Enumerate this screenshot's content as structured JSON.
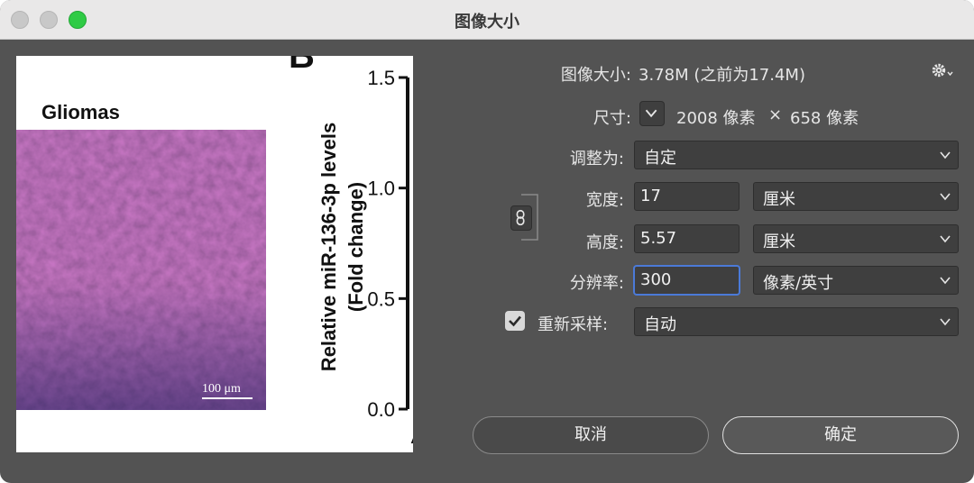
{
  "window": {
    "title": "图像大小"
  },
  "preview": {
    "panel_letter": "B",
    "heading": "Gliomas",
    "scale_bar_label": "100 μm",
    "chart_data": {
      "type": "bar",
      "ylabel_line1": "Relative miR-136-3p levels",
      "ylabel_line2": "(Fold change)",
      "ylim": [
        0,
        1.5
      ],
      "yticks": [
        "1.5",
        "1.0",
        "0.5",
        "0.0"
      ],
      "yticks_values": [
        1.5,
        1.0,
        0.5,
        0.0
      ],
      "xtick_partial": "A"
    }
  },
  "form": {
    "image_size_label": "图像大小:",
    "image_size_value": "3.78M (之前为17.4M)",
    "dimensions_label": "尺寸:",
    "dimensions_width": "2008 像素",
    "dimensions_sep": "×",
    "dimensions_height": "658 像素",
    "fit_to_label": "调整为:",
    "fit_to_value": "自定",
    "width_label": "宽度:",
    "width_value": "17",
    "width_unit": "厘米",
    "height_label": "高度:",
    "height_value": "5.57",
    "height_unit": "厘米",
    "resolution_label": "分辨率:",
    "resolution_value": "300",
    "resolution_unit": "像素/英寸",
    "resample_label": "重新采样:",
    "resample_checked": true,
    "resample_value": "自动"
  },
  "buttons": {
    "cancel": "取消",
    "ok": "确定"
  },
  "icons": {
    "gear": "gear-icon",
    "chevron": "chevron-down-icon",
    "link": "link-icon",
    "check": "checkmark-icon"
  },
  "colors": {
    "zoom_button": "#2fcb45",
    "focus_ring": "#4b7ad8",
    "histo_purple": "#7a3a78"
  }
}
